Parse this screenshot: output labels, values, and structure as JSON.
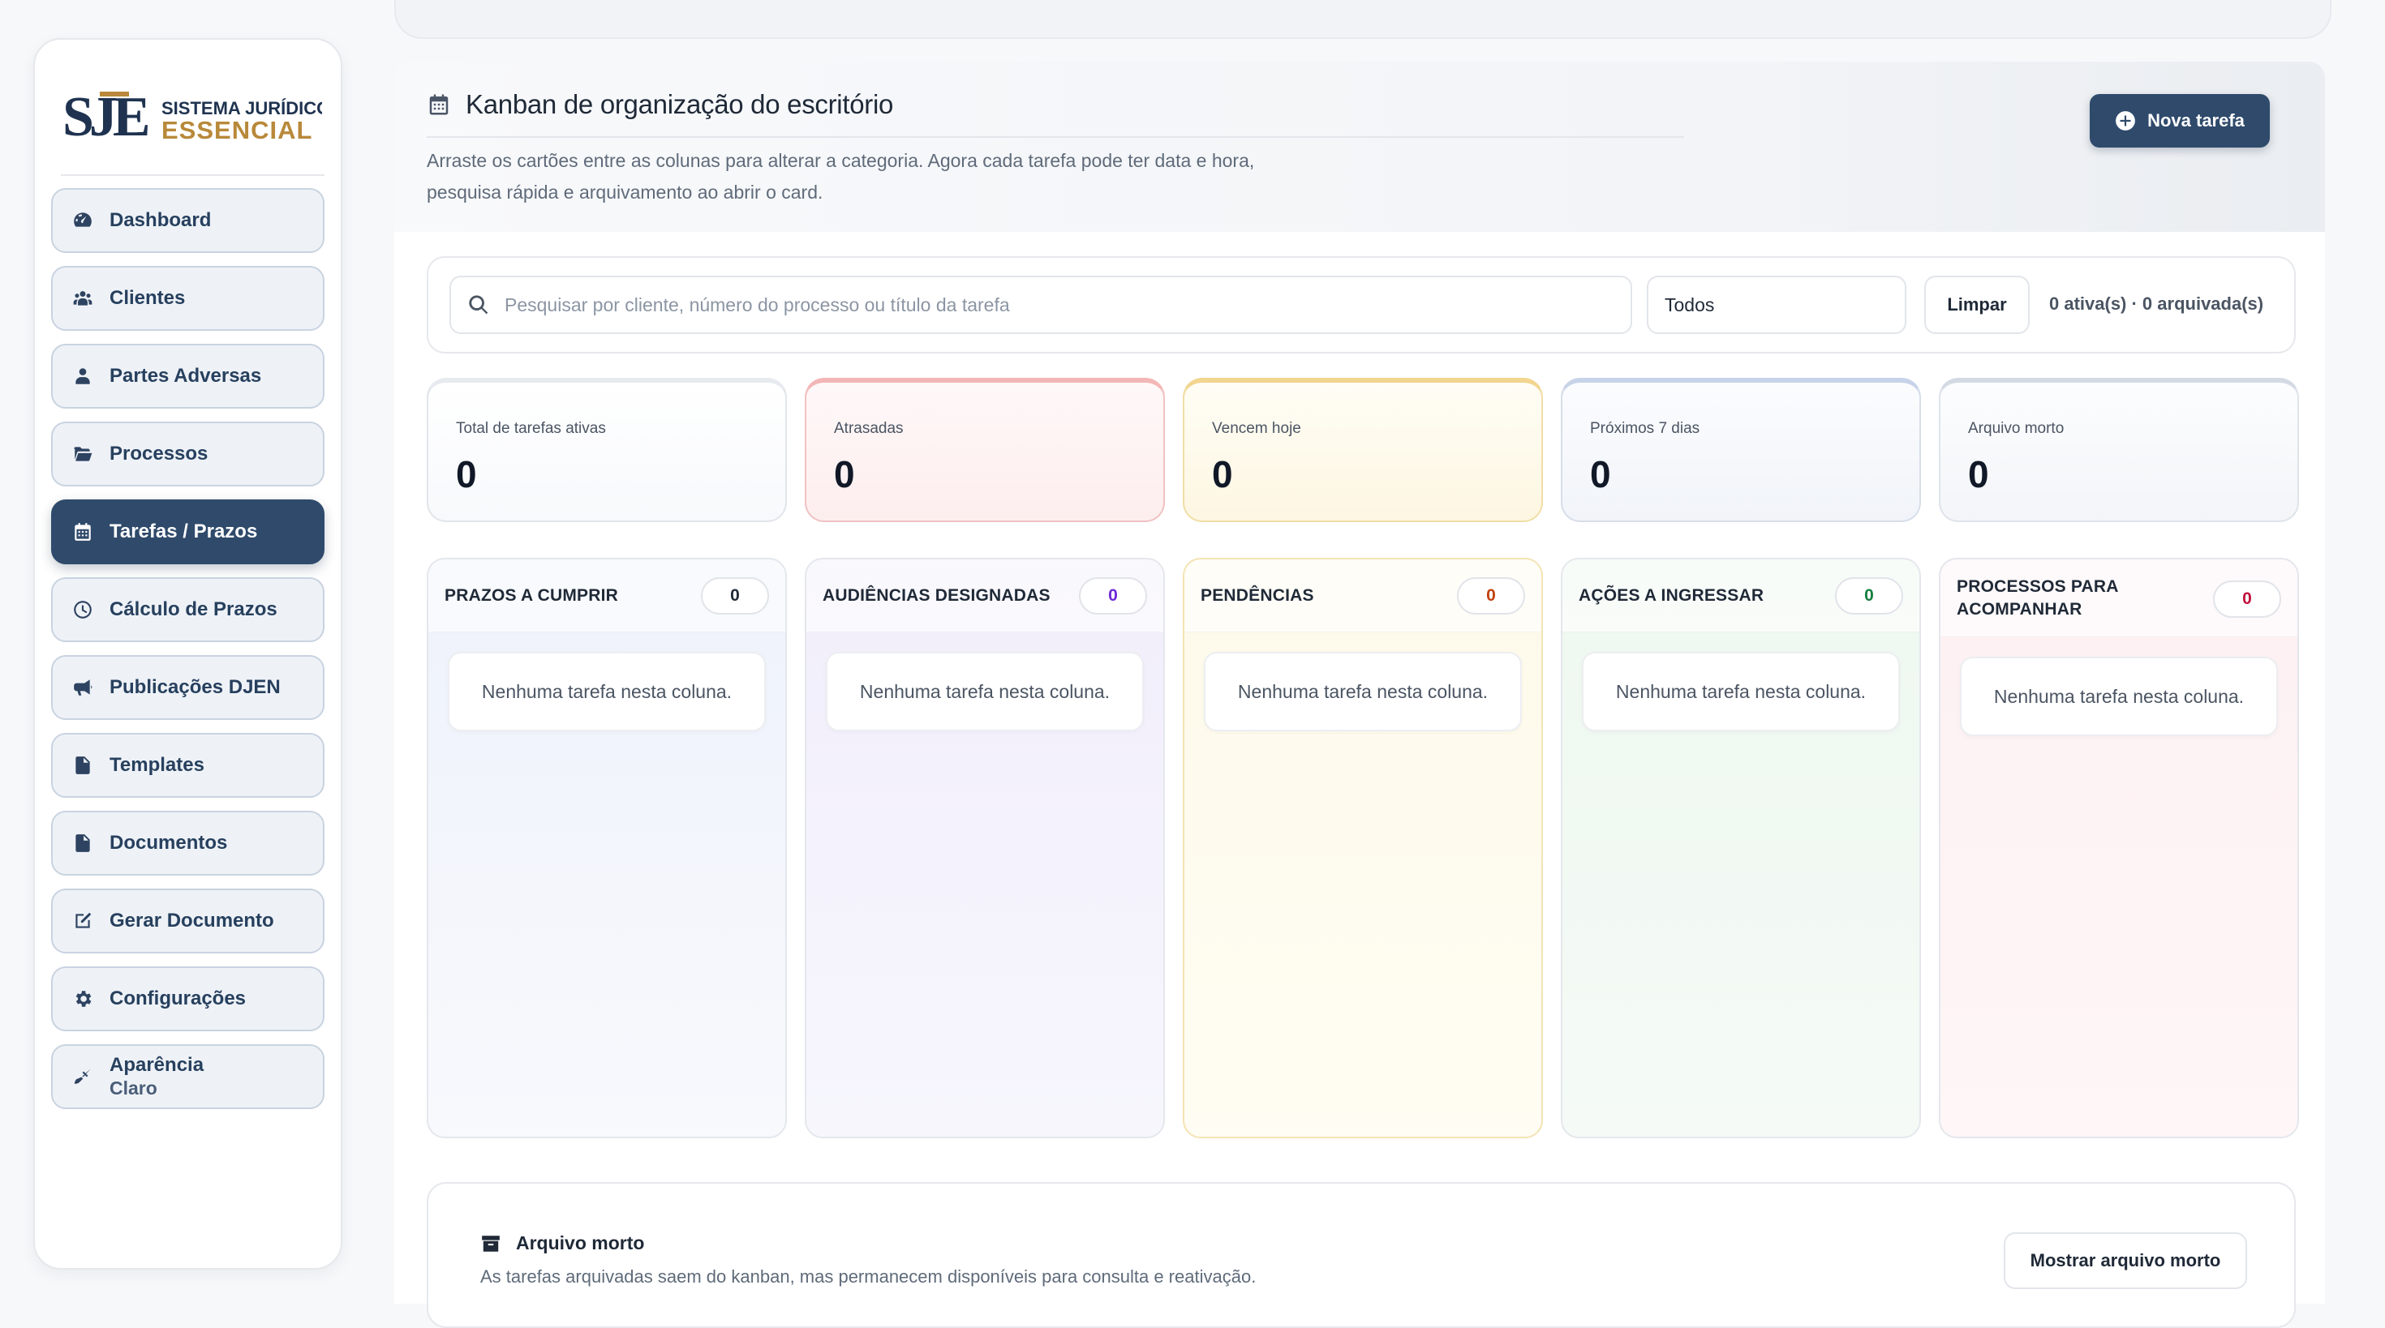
{
  "brand": {
    "logo_mark": "SJE",
    "logo_line1": "SISTEMA JURÍDICO",
    "logo_line2": "ESSENCIAL"
  },
  "sidebar": {
    "items": [
      {
        "label": "Dashboard",
        "icon": "dashboard-gauge-icon",
        "active": false
      },
      {
        "label": "Clientes",
        "icon": "users-icon",
        "active": false
      },
      {
        "label": "Partes Adversas",
        "icon": "user-icon",
        "active": false
      },
      {
        "label": "Processos",
        "icon": "folder-open-icon",
        "active": false
      },
      {
        "label": "Tarefas / Prazos",
        "icon": "calendar-icon",
        "active": true
      },
      {
        "label": "Cálculo de Prazos",
        "icon": "clock-icon",
        "active": false
      },
      {
        "label": "Publicações DJEN",
        "icon": "megaphone-icon",
        "active": false
      },
      {
        "label": "Templates",
        "icon": "file-icon",
        "active": false
      },
      {
        "label": "Documentos",
        "icon": "file-text-icon",
        "active": false
      },
      {
        "label": "Gerar Documento",
        "icon": "edit-document-icon",
        "active": false
      },
      {
        "label": "Configurações",
        "icon": "gear-icon",
        "active": false
      },
      {
        "label": "Aparência",
        "sublabel": "Claro",
        "icon": "brush-icon",
        "active": false
      }
    ]
  },
  "header": {
    "title": "Kanban de organização do escritório",
    "description": "Arraste os cartões entre as colunas para alterar a categoria. Agora cada tarefa pode ter data e hora, pesquisa rápida e arquivamento ao abrir o card.",
    "new_task_label": "Nova tarefa"
  },
  "filters": {
    "search_placeholder": "Pesquisar por cliente, número do processo ou título da tarefa",
    "search_value": "",
    "select_value": "Todos",
    "clear_label": "Limpar",
    "counter": "0 ativa(s) · 0 arquivada(s)"
  },
  "stats": [
    {
      "label": "Total de tarefas ativas",
      "value": "0",
      "accent": "#cfd5de"
    },
    {
      "label": "Atrasadas",
      "value": "0",
      "accent": "#f3b6b6"
    },
    {
      "label": "Vencem hoje",
      "value": "0",
      "accent": "#f2d58e"
    },
    {
      "label": "Próximos 7 dias",
      "value": "0",
      "accent": "#c7d3e8"
    },
    {
      "label": "Arquivo morto",
      "value": "0",
      "accent": "#d3dae4"
    }
  ],
  "columns": [
    {
      "title": "PRAZOS A CUMPRIR",
      "count": "0",
      "count_color": "#1f2937",
      "empty": "Nenhuma tarefa nesta coluna.",
      "tint": "#eef2fb"
    },
    {
      "title": "AUDIÊNCIAS DESIGNADAS",
      "count": "0",
      "count_color": "#6d28d9",
      "empty": "Nenhuma tarefa nesta coluna.",
      "tint": "#f1effb"
    },
    {
      "title": "PENDÊNCIAS",
      "count": "0",
      "count_color": "#c2410c",
      "empty": "Nenhuma tarefa nesta coluna.",
      "tint": "#fefaea"
    },
    {
      "title": "AÇÕES A INGRESSAR",
      "count": "0",
      "count_color": "#15803d",
      "empty": "Nenhuma tarefa nesta coluna.",
      "tint": "#f0f8f1"
    },
    {
      "title": "PROCESSOS PARA ACOMPANHAR",
      "count": "0",
      "count_color": "#be123c",
      "empty": "Nenhuma tarefa nesta coluna.",
      "tint": "#fdf1f3"
    }
  ],
  "archive": {
    "title": "Arquivo morto",
    "description": "As tarefas arquivadas saem do kanban, mas permanecem disponíveis para consulta e reativação.",
    "show_label": "Mostrar arquivo morto"
  },
  "colors": {
    "primary": "#2f4a6b",
    "logo_navy": "#1f3350",
    "logo_gold": "#b8893a"
  }
}
